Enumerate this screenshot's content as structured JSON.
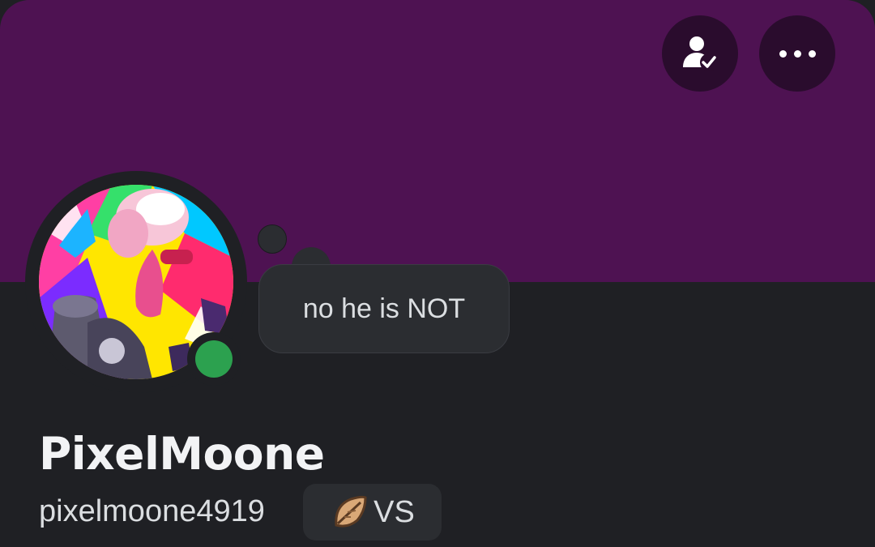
{
  "profile": {
    "display_name": "PixelMoone",
    "username": "pixelmoone4919",
    "custom_status": "no he is NOT",
    "online_status": "online",
    "tag": {
      "icon": "leaf-icon",
      "text": "VS"
    }
  },
  "header": {
    "friend_button_icon": "friend-check-icon",
    "more_button_icon": "more-horizontal-icon"
  },
  "colors": {
    "banner": "#4e1252",
    "background": "#1f2024",
    "status_online": "#2ca14f",
    "button_bg": "#2a0c2d"
  }
}
